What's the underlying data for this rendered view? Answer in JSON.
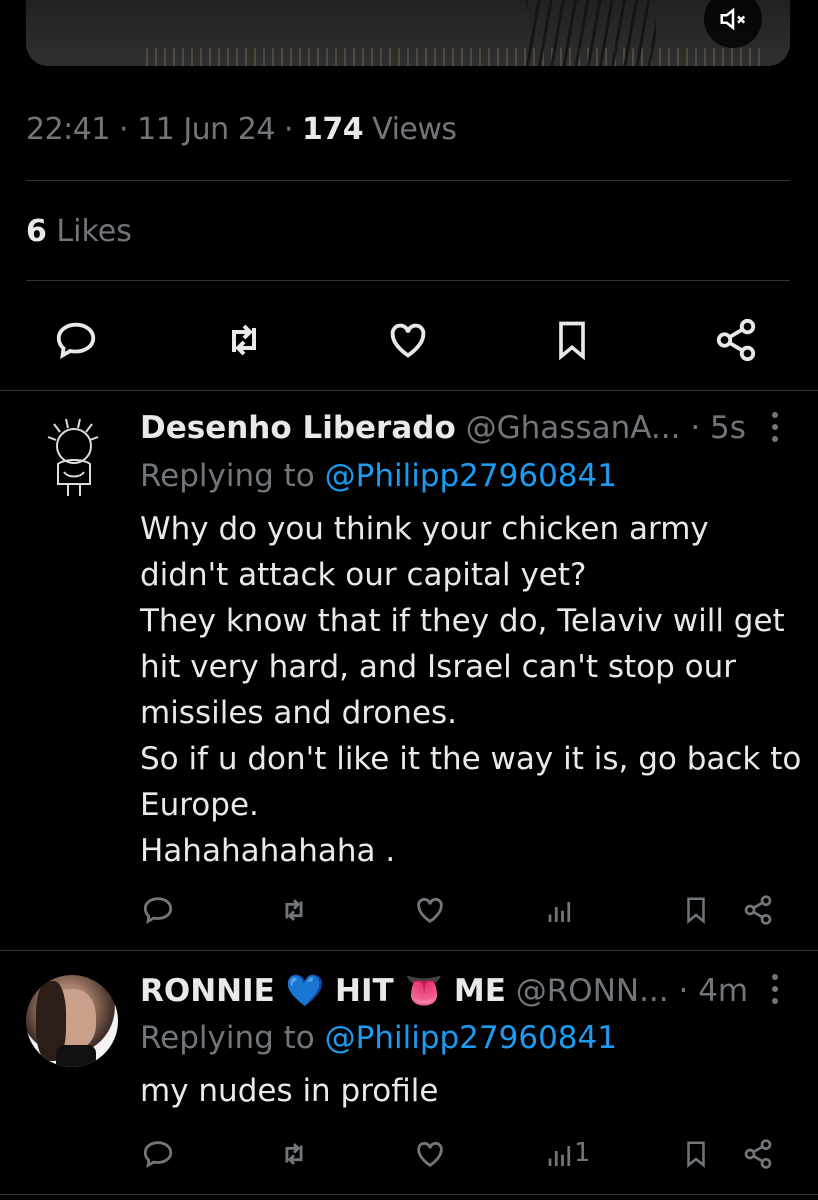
{
  "tweet": {
    "time": "22:41",
    "sep1": "·",
    "date": "11 Jun 24",
    "sep2": "·",
    "views_count": "174",
    "views_label": "Views",
    "likes_count": "6",
    "likes_label": "Likes"
  },
  "replies": [
    {
      "name": "Desenho Liberado",
      "handle": "@GhassanA...",
      "time": "· 5s",
      "replying_prefix": "Replying to",
      "replying_to": "@Philipp27960841",
      "lines": [
        "Why do you think your chicken army",
        "didn't attack our capital yet?",
        "They know that if they do, Telaviv will get",
        "hit very hard, and Israel can't stop our",
        "missiles and drones.",
        "So if u don't like it the way it is, go back to",
        "Europe.",
        "Hahahahahaha ."
      ],
      "views": ""
    },
    {
      "name_part1": "RONNIE",
      "heart_emoji": "💙",
      "name_part2": "HIT",
      "tongue_emoji": "👅",
      "name_part3": "ME",
      "handle": "@RONN...",
      "time": "· 4m",
      "replying_prefix": "Replying to",
      "replying_to": "@Philipp27960841",
      "lines": [
        "my nudes in profile"
      ],
      "views": "1"
    }
  ],
  "icons": [
    "mute-icon",
    "reply-icon",
    "retweet-icon",
    "like-icon",
    "bookmark-icon",
    "share-icon",
    "views-icon",
    "more-icon"
  ],
  "colors": {
    "background": "#000000",
    "text": "#e7e9ea",
    "muted": "#71767b",
    "link": "#1d9bf0",
    "divider": "#2f3336"
  }
}
